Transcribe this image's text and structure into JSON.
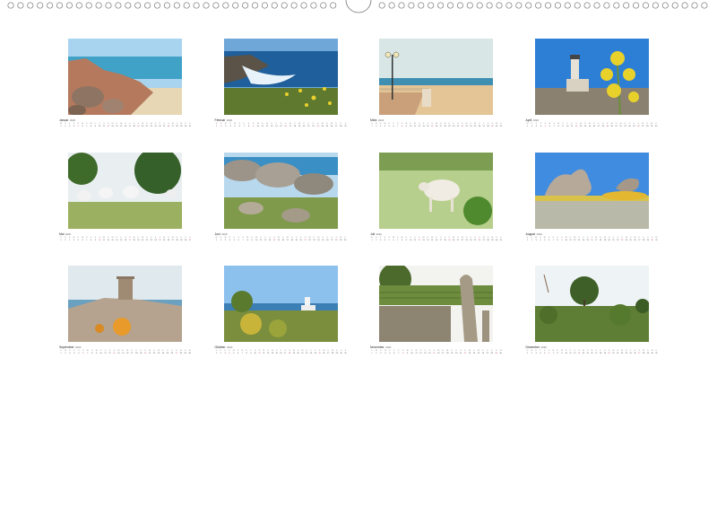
{
  "calendar": {
    "year": "2020",
    "months": [
      {
        "name": "Januar",
        "days": 31,
        "start": 2,
        "photo": "rocky-beach"
      },
      {
        "name": "Februar",
        "days": 29,
        "start": 5,
        "photo": "coast-surf-flowers"
      },
      {
        "name": "März",
        "days": 31,
        "start": 6,
        "photo": "promenade-beach-lamp"
      },
      {
        "name": "April",
        "days": 30,
        "start": 2,
        "photo": "lighthouse-fennel"
      },
      {
        "name": "Mai",
        "days": 31,
        "start": 4,
        "photo": "goats-trees"
      },
      {
        "name": "Juni",
        "days": 30,
        "start": 0,
        "photo": "granite-coast"
      },
      {
        "name": "Juli",
        "days": 31,
        "start": 2,
        "photo": "cow-meadow"
      },
      {
        "name": "August",
        "days": 31,
        "start": 5,
        "photo": "granite-rocks-sky"
      },
      {
        "name": "September",
        "days": 30,
        "start": 1,
        "photo": "coastal-tower"
      },
      {
        "name": "Oktober",
        "days": 31,
        "start": 3,
        "photo": "lighthouse-macchia"
      },
      {
        "name": "November",
        "days": 30,
        "start": 6,
        "photo": "giants-tomb-vineyard"
      },
      {
        "name": "Dezember",
        "days": 31,
        "start": 1,
        "photo": "macchia-trees"
      }
    ],
    "weekday_letters": [
      "M",
      "D",
      "M",
      "D",
      "F",
      "S",
      "S"
    ]
  },
  "colors": {
    "sky": "#a9d4ef",
    "sea": "#2f7fb8",
    "sand": "#e8d7b5",
    "rock": "#9a8a78",
    "green": "#6b8f3a",
    "yellow": "#e9d12c"
  }
}
